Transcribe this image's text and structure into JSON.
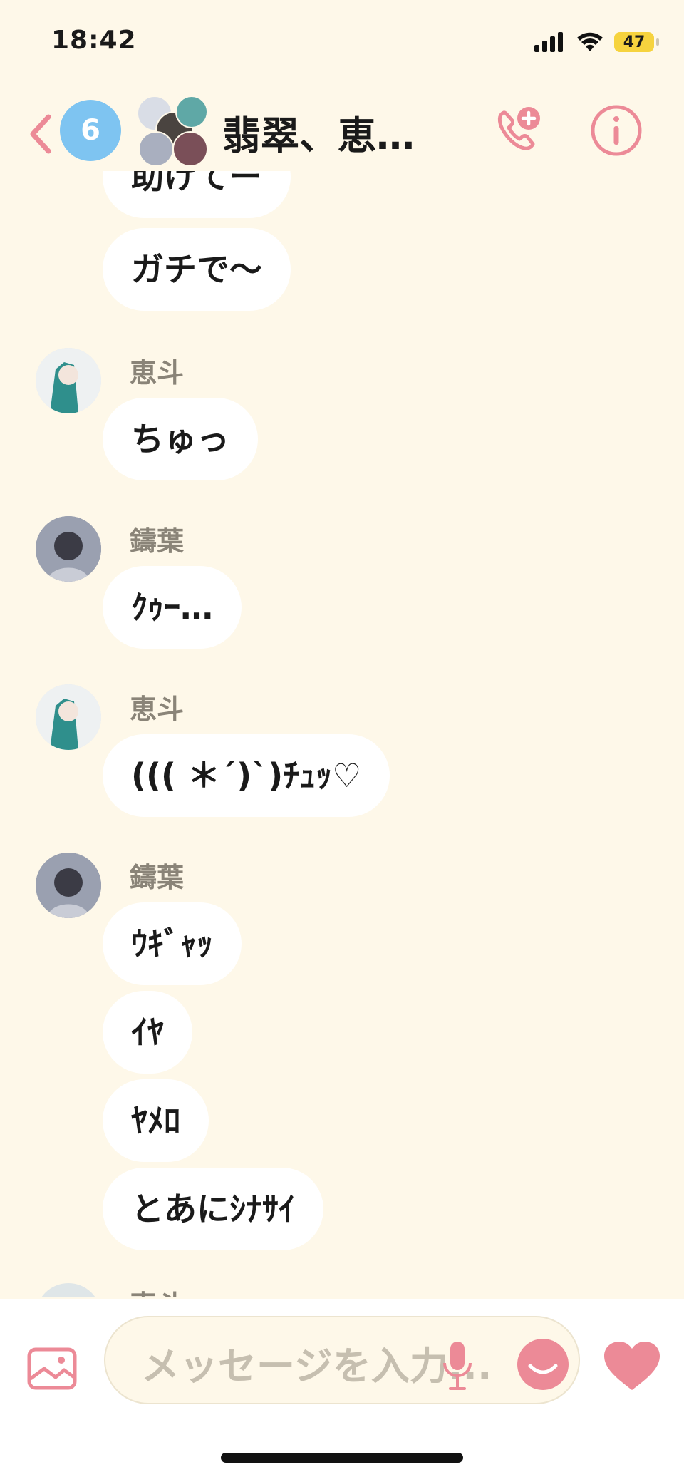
{
  "status_bar": {
    "time": "18:42",
    "battery": "47"
  },
  "header": {
    "unread_count": "6",
    "title": "翡翠、恵…"
  },
  "messages": [
    {
      "text": "助けてー"
    },
    {
      "text": "ガチで〜"
    },
    {
      "sender": "恵斗",
      "text": "ちゅっ"
    },
    {
      "sender": "鑄葉",
      "text": "ｸｩｰ…"
    },
    {
      "sender": "恵斗",
      "text": "((( ＊´)`)ﾁｭｯ♡"
    },
    {
      "sender": "鑄葉",
      "text": "ｳｷﾞｬｯ"
    },
    {
      "text": "ｲﾔ"
    },
    {
      "text": "ﾔﾒﾛ"
    },
    {
      "text": "とあにｼﾅｻｲ"
    },
    {
      "sender": "恵斗"
    }
  ],
  "input": {
    "placeholder": "メッセージを入力..."
  },
  "colors": {
    "accent": "#EC8A97",
    "badge": "#7EC4F1",
    "background": "#FEF8E9"
  }
}
